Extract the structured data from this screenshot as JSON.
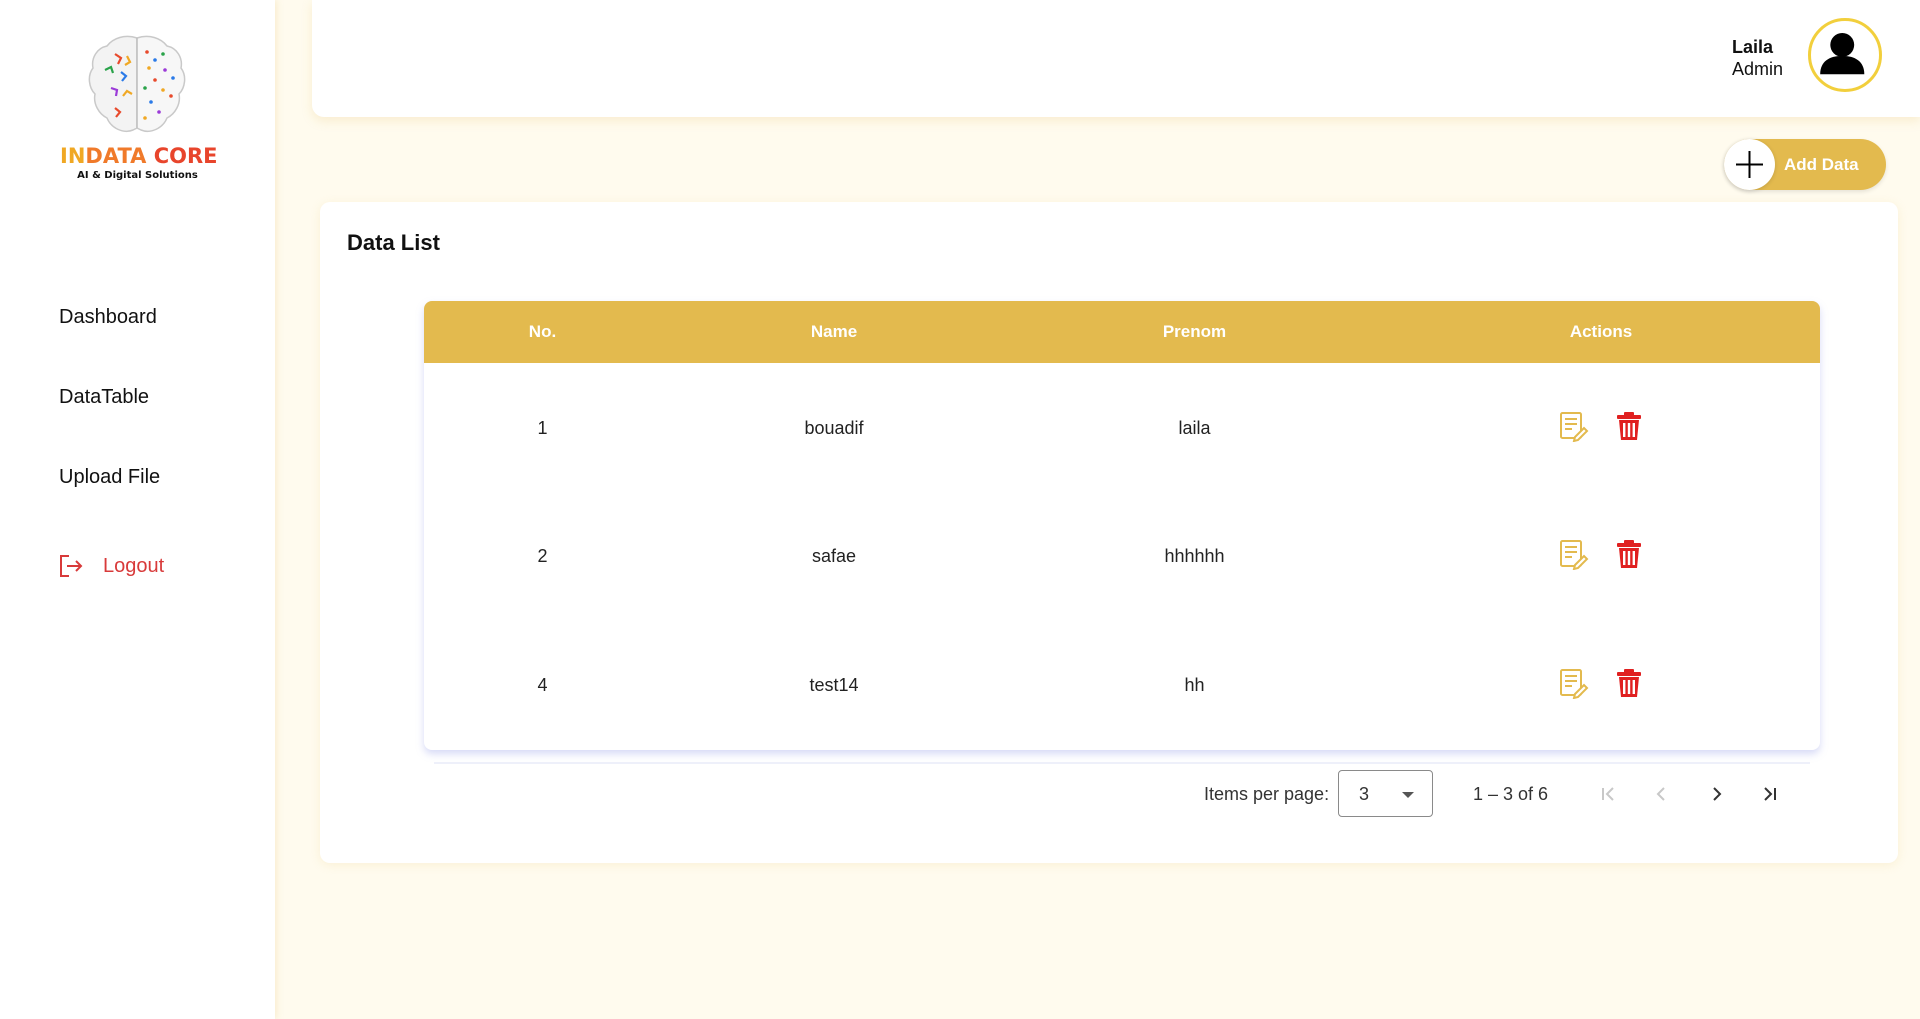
{
  "brand": {
    "name_part1": "IN",
    "name_part2": "DATA ",
    "name_part3": "CORE",
    "tagline": "AI & Digital Solutions"
  },
  "sidebar": {
    "items": [
      {
        "label": "Dashboard"
      },
      {
        "label": "DataTable"
      },
      {
        "label": "Upload File"
      }
    ],
    "logout_label": "Logout"
  },
  "header": {
    "user_name": "Laila",
    "user_role": "Admin"
  },
  "toolbar": {
    "add_label": "Add Data"
  },
  "card": {
    "title": "Data List"
  },
  "table": {
    "columns": [
      "No.",
      "Name",
      "Prenom",
      "Actions"
    ],
    "rows": [
      {
        "no": "1",
        "name": "bouadif",
        "prenom": "laila"
      },
      {
        "no": "2",
        "name": "safae",
        "prenom": "hhhhhh"
      },
      {
        "no": "4",
        "name": "test14",
        "prenom": "hh"
      }
    ]
  },
  "paginator": {
    "items_per_page_label": "Items per page:",
    "items_per_page_value": "3",
    "range_label": "1 – 3 of 6"
  },
  "colors": {
    "accent": "#e3ba4e",
    "danger": "#e02020",
    "logout": "#d83a3a",
    "background": "#fffbee"
  }
}
